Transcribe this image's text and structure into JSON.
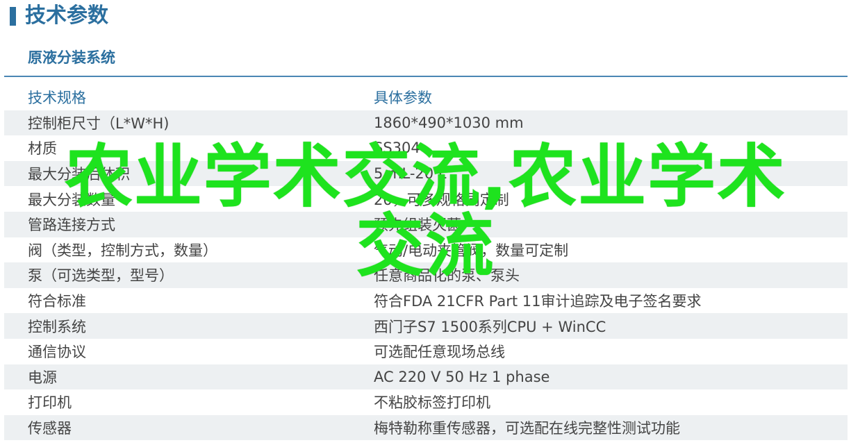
{
  "page_title": "技术参数",
  "section_title": "原液分装系统",
  "table": {
    "headers": [
      "技术规格",
      "具体参数"
    ],
    "rows": [
      [
        "控制柜尺寸（L*W*H)",
        "1860*490*1030 mm"
      ],
      [
        "材质",
        "SS304"
      ],
      [
        "最大分装后体积",
        "5 mL-20 L"
      ],
      [
        "最大分装数量",
        "20，可多规格同定制"
      ],
      [
        "管路连接方式",
        "预先组装灭菌"
      ],
      [
        "阀（类型，控制方式，数量）",
        "气动/电动夹管阀，数量可定制"
      ],
      [
        "泵（可选类型，型号）",
        "任意商品化的泵、泵头"
      ],
      [
        "符合标准",
        "符合FDA 21CFR Part 11审计追踪及电子签名要求"
      ],
      [
        "控制系统",
        "西门子S7 1500系列CPU + WinCC"
      ],
      [
        "通信协议",
        "可选配任意现场总线"
      ],
      [
        "电源",
        "AC 220 V 50 Hz 1 phase"
      ],
      [
        "打印机",
        "不粘胶标签打印机"
      ],
      [
        "传感器",
        "梅特勒称重传感器，可选配在线完整性测试功能"
      ]
    ]
  },
  "watermark": {
    "line1": "农业学术交流,农业学术",
    "line2": "交流"
  }
}
